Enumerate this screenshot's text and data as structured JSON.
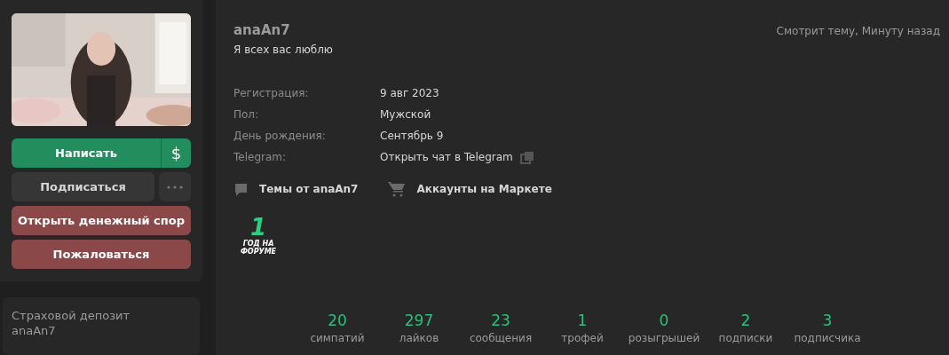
{
  "sidebar": {
    "buttons": [
      {
        "label": "Написать",
        "kind": "primary",
        "extra": "$"
      },
      {
        "label": "Подписаться",
        "kind": "secondary"
      },
      {
        "label": "Открыть денежный спор",
        "kind": "danger"
      },
      {
        "label": "Пожаловаться",
        "kind": "danger"
      }
    ],
    "deposit": {
      "title": "Страховой депозит",
      "name": "anaAn7"
    }
  },
  "profile": {
    "username": "anaAn7",
    "status": "Я всех вас люблю",
    "activity": "Смотрит тему, Минуту назад",
    "info": [
      {
        "label": "Регистрация:",
        "value": "9 авг 2023"
      },
      {
        "label": "Пол:",
        "value": "Мужской"
      },
      {
        "label": "День рождения:",
        "value": "Сентябрь 9"
      },
      {
        "label": "Telegram:",
        "value": "Открыть чат в Telegram",
        "kind": "link"
      }
    ],
    "links": [
      {
        "label": "Темы от anaAn7",
        "kind": "topics"
      },
      {
        "label": "Аккаунты на Маркете",
        "kind": "market"
      }
    ],
    "badge": {
      "number": "1",
      "caption_1": "ГОД НА",
      "caption_2": "ФОРУМЕ"
    },
    "stats": [
      {
        "value": "20",
        "label": "симпатий"
      },
      {
        "value": "297",
        "label": "лайков"
      },
      {
        "value": "23",
        "label": "сообщения"
      },
      {
        "value": "1",
        "label": "трофей"
      },
      {
        "value": "0",
        "label": "розыгрышей"
      },
      {
        "value": "2",
        "label": "подписки"
      },
      {
        "value": "3",
        "label": "подписчика"
      }
    ]
  }
}
